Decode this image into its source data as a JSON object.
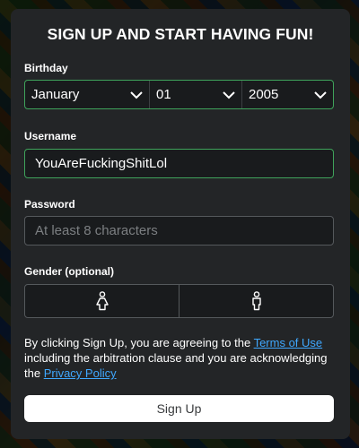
{
  "form": {
    "heading": "SIGN UP AND START HAVING FUN!",
    "birthday": {
      "label": "Birthday",
      "month": "January",
      "day": "01",
      "year": "2005"
    },
    "username": {
      "label": "Username",
      "value": "YouAreFuckingShitLol"
    },
    "password": {
      "label": "Password",
      "placeholder": "At least 8 characters"
    },
    "gender": {
      "label": "Gender (optional)",
      "options": [
        "female-icon",
        "male-icon"
      ]
    },
    "terms": {
      "prefix": "By clicking Sign Up, you are agreeing to the ",
      "terms_link": "Terms of Use",
      "middle": " including the arbitration clause and you are acknowledging the ",
      "privacy_link": "Privacy Policy"
    },
    "submit_label": "Sign Up"
  },
  "colors": {
    "card_bg": "#232527",
    "valid_border": "#3fa35b",
    "link": "#3fa8ff",
    "button_bg": "#ffffff"
  }
}
